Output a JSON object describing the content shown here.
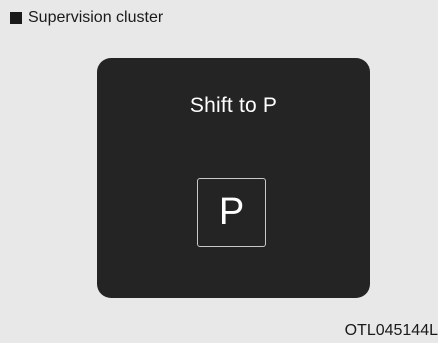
{
  "caption": {
    "icon": "square-bullet-icon",
    "text": "Supervision cluster"
  },
  "cluster": {
    "message": "Shift to P",
    "gear_indicator": "P"
  },
  "reference_code": "OTL045144L",
  "colors": {
    "page_background": "#e8e8e8",
    "panel_background": "#242424",
    "panel_text": "#ffffff",
    "indicator_border": "#c8c8c8"
  }
}
